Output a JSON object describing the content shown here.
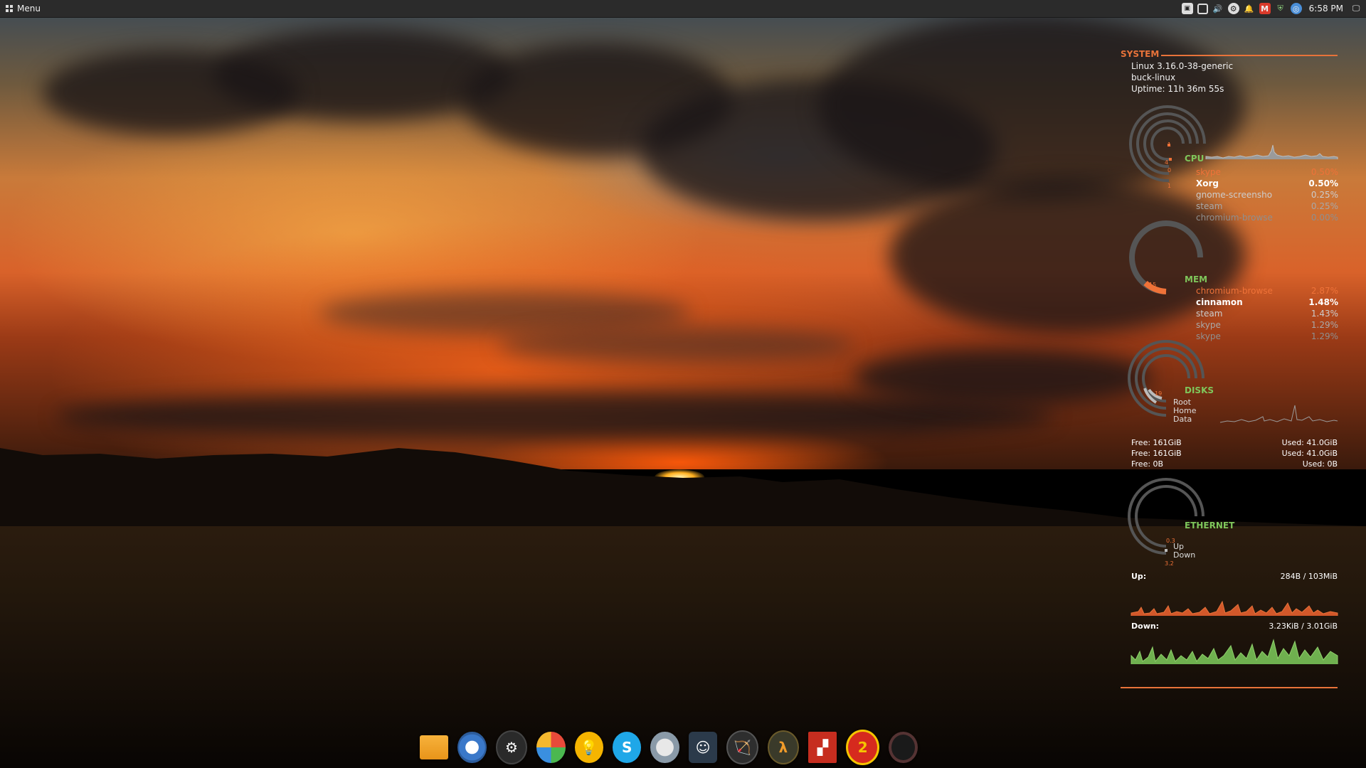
{
  "panel": {
    "menu_label": "Menu",
    "clock": "6:58 PM",
    "tray_icons": [
      "screenshot-icon",
      "window-icon",
      "volume-icon",
      "steam-icon",
      "notification-icon",
      "gmail-icon",
      "shield-icon",
      "chromium-icon",
      "network-icon"
    ]
  },
  "conky": {
    "system": {
      "title": "SYSTEM",
      "kernel": "Linux 3.16.0-38-generic",
      "hostname": "buck-linux",
      "uptime": "Uptime: 11h 36m 55s"
    },
    "cpu": {
      "title": "CPU",
      "cores": [
        "1",
        "4",
        "0",
        "1"
      ],
      "processes": [
        {
          "name": "skype",
          "value": "0.50%"
        },
        {
          "name": "Xorg",
          "value": "0.50%"
        },
        {
          "name": "gnome-screensho",
          "value": "0.25%"
        },
        {
          "name": "steam",
          "value": "0.25%"
        },
        {
          "name": "chromium-browse",
          "value": "0.00%"
        }
      ]
    },
    "mem": {
      "title": "MEM",
      "gauge_value": "15",
      "processes": [
        {
          "name": "chromium-browse",
          "value": "2.87%"
        },
        {
          "name": "cinnamon",
          "value": "1.48%"
        },
        {
          "name": "steam",
          "value": "1.43%"
        },
        {
          "name": "skype",
          "value": "1.29%"
        },
        {
          "name": "skype",
          "value": "1.29%"
        }
      ]
    },
    "disks": {
      "title": "DISKS",
      "gauge_value": "19",
      "labels": [
        "Root",
        "Home",
        "Data"
      ],
      "free": [
        "Free: 161GiB",
        "Free: 161GiB",
        "Free: 0B"
      ],
      "used": [
        "Used: 41.0GiB",
        "Used: 41.0GiB",
        "Used: 0B"
      ]
    },
    "ethernet": {
      "title": "ETHERNET",
      "up_value": "0.3",
      "down_value": "3.2",
      "up_label": "Up",
      "down_label": "Down",
      "up_heading": "Up:",
      "up_stats": "284B  / 103MiB",
      "down_heading": "Down:",
      "down_stats": "3.23KiB / 3.01GiB"
    },
    "colors": {
      "accent": "#e8733a",
      "green": "#7fc65b"
    }
  },
  "dock": {
    "items": [
      {
        "name": "files-icon",
        "glyph": ""
      },
      {
        "name": "chromium-icon",
        "glyph": ""
      },
      {
        "name": "steam-icon",
        "glyph": ""
      },
      {
        "name": "pinwheel-icon",
        "glyph": ""
      },
      {
        "name": "lightbulb-icon",
        "glyph": ""
      },
      {
        "name": "skype-icon",
        "glyph": "S"
      },
      {
        "name": "browser-globe-icon",
        "glyph": ""
      },
      {
        "name": "fallout-icon",
        "glyph": ""
      },
      {
        "name": "bow-icon",
        "glyph": ""
      },
      {
        "name": "half-life-icon",
        "glyph": ""
      },
      {
        "name": "rust-icon",
        "glyph": ""
      },
      {
        "name": "half-life-2-icon",
        "glyph": "2"
      },
      {
        "name": "portal-icon",
        "glyph": ""
      }
    ]
  }
}
